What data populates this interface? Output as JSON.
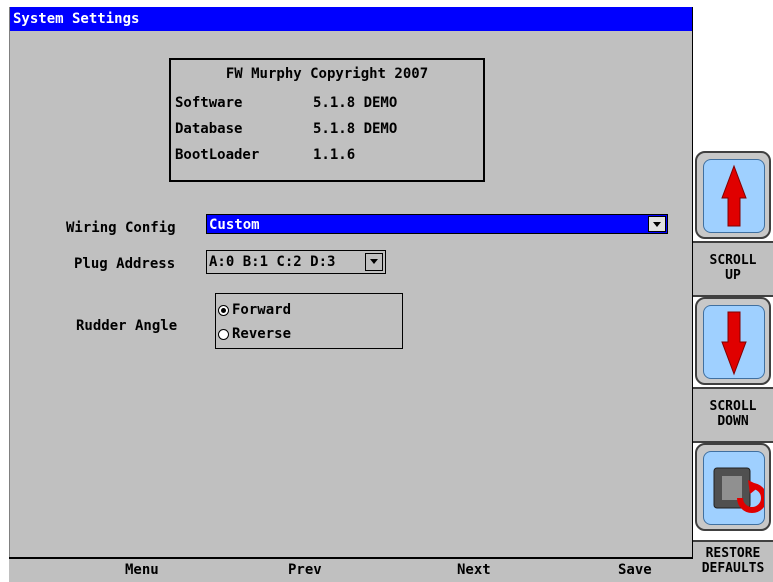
{
  "window": {
    "title": "System Settings"
  },
  "info": {
    "copyright": "FW Murphy Copyright 2007",
    "rows": [
      {
        "label": "Software",
        "value": "5.1.8 DEMO"
      },
      {
        "label": "Database",
        "value": "5.1.8 DEMO"
      },
      {
        "label": "BootLoader",
        "value": "1.1.6"
      }
    ]
  },
  "form": {
    "wiring_label": "Wiring Config",
    "wiring_value": "Custom",
    "plug_label": "Plug Address",
    "plug_value": "A:0 B:1 C:2 D:3",
    "rudder_label": "Rudder Angle",
    "rudder_options": [
      {
        "label": "Forward",
        "selected": true
      },
      {
        "label": "Reverse",
        "selected": false
      }
    ]
  },
  "bottombar": {
    "menu": "Menu",
    "prev": "Prev",
    "next": "Next",
    "save": "Save"
  },
  "side": {
    "scroll_up_1": "SCROLL",
    "scroll_up_2": "UP",
    "scroll_down_1": "SCROLL",
    "scroll_down_2": "DOWN",
    "restore_1": "RESTORE",
    "restore_2": "DEFAULTS"
  },
  "colors": {
    "title_bg": "#0000ff",
    "panel_bg": "#c0c0c0",
    "arrow_red": "#e00000",
    "button_face": "#9fd0ff"
  }
}
